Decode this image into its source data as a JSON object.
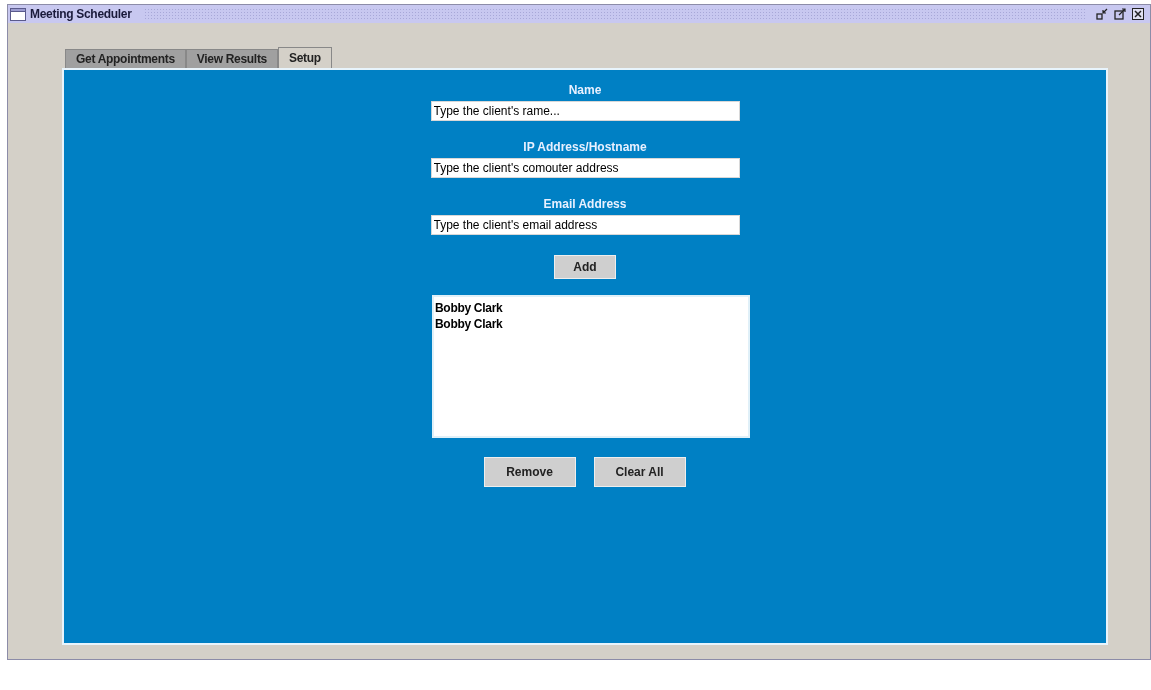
{
  "window": {
    "title": "Meeting Scheduler"
  },
  "tabs": [
    {
      "label": "Get Appointments",
      "selected": false
    },
    {
      "label": "View Results",
      "selected": false
    },
    {
      "label": "Setup",
      "selected": true
    }
  ],
  "fields": [
    {
      "label": "Name",
      "value": "Type the client's rame..."
    },
    {
      "label": "IP Address/Hostname",
      "value": "Type the client's comouter address"
    },
    {
      "label": "Email Address",
      "value": "Type the client's email address"
    }
  ],
  "add_button": "Add",
  "clients": [
    "Bobby Clark",
    "Bobby Clark"
  ],
  "buttons": [
    "Remove",
    "Clear All"
  ]
}
